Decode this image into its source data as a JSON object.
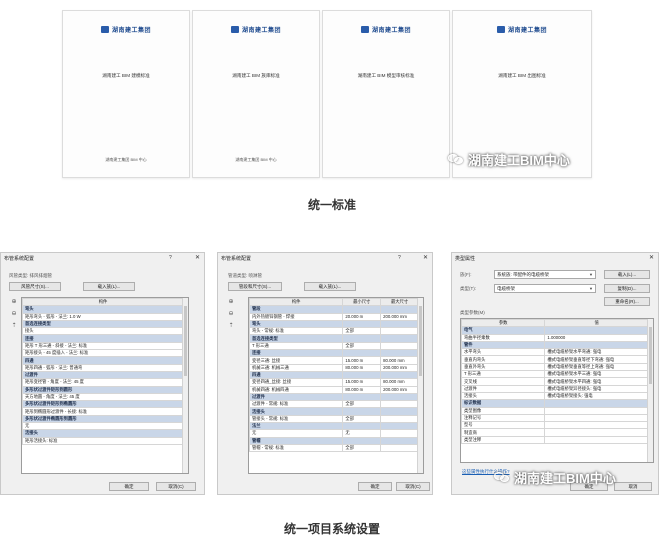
{
  "documents": {
    "logo_text": "湖南建工集团",
    "covers": [
      {
        "title": "湖南建工 BIM 建模标准",
        "footer": "湖南建工集团 BIM 中心"
      },
      {
        "title": "湖南建工 BIM 族库标准",
        "footer": "湖南建工集团 BIM 中心"
      },
      {
        "title": "湖南建工 BIM 模型审核标准",
        "footer": ""
      },
      {
        "title": "湖南建工 BIM 出图标准",
        "footer": ""
      }
    ]
  },
  "watermark_text": "湖南建工BIM中心",
  "caption_standard": "统一标准",
  "caption_settings": "统一项目系统设置",
  "dialog1": {
    "title": "布管系统配置",
    "help": "?",
    "close": "✕",
    "type_label": "风管类型: 排风排烟管",
    "btn_size": "风管尺寸(S)...",
    "btn_load": "载入族(L)...",
    "col_header": "构件",
    "rows": [
      {
        "text": "弯头",
        "hdr": true
      },
      {
        "text": "矩形弯头 - 弧形 - 法兰: 1.0 W",
        "hdr": false
      },
      {
        "text": "首选连接类型",
        "hdr": true
      },
      {
        "text": "接头",
        "hdr": false
      },
      {
        "text": "连接",
        "hdr": true
      },
      {
        "text": "矩形 T 形三通 - 斜接 - 法兰: 标准",
        "hdr": false
      },
      {
        "text": "矩形接头 - 45 度插入 - 法兰: 标准",
        "hdr": false
      },
      {
        "text": "四通",
        "hdr": true
      },
      {
        "text": "矩形四通 - 弧形 - 法兰: 普通弯",
        "hdr": false
      },
      {
        "text": "过渡件",
        "hdr": true
      },
      {
        "text": "矩形变径管 - 角度 - 法兰: 45 度",
        "hdr": false
      },
      {
        "text": "多形状过渡件矩形到圆形",
        "hdr": true
      },
      {
        "text": "天方地圆 - 角度 - 法兰: 45 度",
        "hdr": false
      },
      {
        "text": "多形状过渡件矩形到椭圆形",
        "hdr": true
      },
      {
        "text": "矩形到椭圆形过渡件 - 长接: 标准",
        "hdr": false
      },
      {
        "text": "多形状过渡件椭圆形到圆形",
        "hdr": true
      },
      {
        "text": "无",
        "hdr": false
      },
      {
        "text": "活接头",
        "hdr": true
      },
      {
        "text": "矩形活接头: 标准",
        "hdr": false
      }
    ],
    "ok": "确定",
    "cancel": "取消(C)"
  },
  "dialog2": {
    "title": "布管系统配置",
    "help": "?",
    "close": "✕",
    "type_label": "管道类型: 喷淋管",
    "btn_size": "管段和尺寸(S)...",
    "btn_load": "载入族(L)...",
    "col_headers": [
      "构件",
      "最小尺寸",
      "最大尺寸"
    ],
    "rows": [
      {
        "cells": [
          "管段",
          "",
          ""
        ],
        "hdr": true
      },
      {
        "cells": [
          "内外热镀锌钢管 - 焊接",
          "20.000 m",
          "200.000 mm"
        ],
        "hdr": false
      },
      {
        "cells": [
          "弯头",
          "",
          ""
        ],
        "hdr": true
      },
      {
        "cells": [
          "弯头 - 常规: 标准",
          "全部",
          ""
        ],
        "hdr": false
      },
      {
        "cells": [
          "首选连接类型",
          "",
          ""
        ],
        "hdr": true
      },
      {
        "cells": [
          "T 形三通",
          "全部",
          ""
        ],
        "hdr": false
      },
      {
        "cells": [
          "连接",
          "",
          ""
        ],
        "hdr": true
      },
      {
        "cells": [
          "变径三通: 丝接",
          "15.000 m",
          "80.000 mm"
        ],
        "hdr": false
      },
      {
        "cells": [
          "机械三通: 机械三通",
          "80.000 m",
          "200.000 mm"
        ],
        "hdr": false
      },
      {
        "cells": [
          "四通",
          "",
          ""
        ],
        "hdr": true
      },
      {
        "cells": [
          "变径四通_丝接: 丝接",
          "15.000 m",
          "80.000 mm"
        ],
        "hdr": false
      },
      {
        "cells": [
          "机械四通: 机械四通",
          "80.000 m",
          "200.000 mm"
        ],
        "hdr": false
      },
      {
        "cells": [
          "过渡件",
          "",
          ""
        ],
        "hdr": true
      },
      {
        "cells": [
          "过渡件 - 常规: 标准",
          "全部",
          ""
        ],
        "hdr": false
      },
      {
        "cells": [
          "活接头",
          "",
          ""
        ],
        "hdr": true
      },
      {
        "cells": [
          "管接头 - 常规: 标准",
          "全部",
          ""
        ],
        "hdr": false
      },
      {
        "cells": [
          "法兰",
          "",
          ""
        ],
        "hdr": true
      },
      {
        "cells": [
          "无",
          "无",
          ""
        ],
        "hdr": false
      },
      {
        "cells": [
          "管帽",
          "",
          ""
        ],
        "hdr": true
      },
      {
        "cells": [
          "管帽 - 常规: 标准",
          "全部",
          ""
        ],
        "hdr": false
      }
    ],
    "ok": "确定",
    "cancel": "取消(C)"
  },
  "dialog3": {
    "title": "类型属性",
    "close": "✕",
    "family_label": "族(F):",
    "family_value": "系统族: 带配件的电缆桥架",
    "type_label": "类型(T):",
    "type_value": "电缆桥架",
    "btn_load": "载入(L)...",
    "btn_copy": "复制(D)...",
    "btn_rename": "重命名(R)...",
    "params_label": "类型参数(M)",
    "col_headers": [
      "参数",
      "值"
    ],
    "rows": [
      {
        "cells": [
          "电气",
          ""
        ],
        "hdr": true
      },
      {
        "cells": [
          "弯曲半径乘数",
          "1.000000"
        ],
        "hdr": false
      },
      {
        "cells": [
          "管件",
          ""
        ],
        "hdr": true
      },
      {
        "cells": [
          "水平弯头",
          "槽式电缆桥架水平弯通: 强电"
        ],
        "hdr": false
      },
      {
        "cells": [
          "垂直内弯头",
          "槽式电缆桥架垂直等径下弯通: 强电"
        ],
        "hdr": false
      },
      {
        "cells": [
          "垂直外弯头",
          "槽式电缆桥架垂直等径上弯通: 强电"
        ],
        "hdr": false
      },
      {
        "cells": [
          "T 形三通",
          "槽式电缆桥架水平三通: 强电"
        ],
        "hdr": false
      },
      {
        "cells": [
          "交叉线",
          "槽式电缆桥架水平四通: 强电"
        ],
        "hdr": false
      },
      {
        "cells": [
          "过渡件",
          "槽式电缆桥架异径接头: 强电"
        ],
        "hdr": false
      },
      {
        "cells": [
          "活接头",
          "槽式电缆桥架接头: 强电"
        ],
        "hdr": false
      },
      {
        "cells": [
          "标识数据",
          ""
        ],
        "hdr": true
      },
      {
        "cells": [
          "类型图像",
          ""
        ],
        "hdr": false
      },
      {
        "cells": [
          "注释记号",
          ""
        ],
        "hdr": false
      },
      {
        "cells": [
          "型号",
          ""
        ],
        "hdr": false
      },
      {
        "cells": [
          "制造商",
          ""
        ],
        "hdr": false
      },
      {
        "cells": [
          "类型注释",
          ""
        ],
        "hdr": false
      }
    ],
    "preview_link": "这些属性执行什么操作?",
    "ok": "确定",
    "cancel": "取消"
  }
}
